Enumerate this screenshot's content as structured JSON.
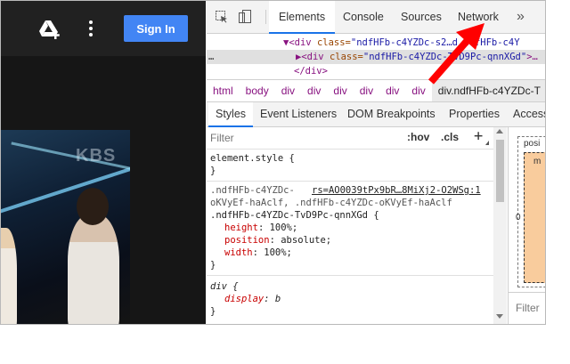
{
  "page": {
    "signin_label": "Sign In",
    "video_watermark": "KBS"
  },
  "devtools": {
    "tabs": [
      "Elements",
      "Console",
      "Sources",
      "Network"
    ],
    "active_tab": "Elements",
    "more_tabs": "»",
    "dom_lines": [
      {
        "prefix": "▼<div ",
        "attr": "class=",
        "val": "\"ndfHFb-c4YZDc-s2…d ndfHFb-c4Y"
      },
      {
        "prefix": "▶<div ",
        "attr": "class=",
        "val": "\"ndfHFb-c4YZDc-TvD9Pc-qnnXGd\"",
        "suffix": ">…",
        "ellipsis": "…"
      },
      {
        "prefix": "</div>",
        "attr": "",
        "val": ""
      }
    ],
    "breadcrumbs": [
      "html",
      "body",
      "div",
      "div",
      "div",
      "div",
      "div",
      "div",
      "div.ndfHFb-c4YZDc-T"
    ],
    "subtabs": [
      "Styles",
      "Event Listeners",
      "DOM Breakpoints",
      "Properties",
      "Access"
    ],
    "active_subtab": "Styles",
    "filter_placeholder": "Filter",
    "hov": ":hov",
    "cls": ".cls",
    "plus": "+",
    "styles": {
      "element_style": "element.style {",
      "close": "}",
      "rule1_selector_line1": "ndfHFb-c4YZDc-",
      "rule1_selector_line1_prefix": ".",
      "rule1_link": "rs=AO0039tPx9bR…8MiXj2-O2WSg:1",
      "rule1_selector_line2": "oKVyEf-haAclf, .ndfHFb-c4YZDc-oKVyEf-haAclf",
      "rule1_selector_line3": ".ndfHFb-c4YZDc-TvD9Pc-qnnXGd {",
      "rule1_props": [
        {
          "name": "height",
          "value": "100%;"
        },
        {
          "name": "position",
          "value": "absolute;"
        },
        {
          "name": "width",
          "value": "100%;"
        }
      ],
      "rule2_selector": "div {",
      "rule2_prop_name": "display",
      "rule2_prop_value": "b"
    },
    "boxmodel": {
      "label": "posi",
      "margin_label": "m",
      "zero": "0",
      "filter": "Filter"
    }
  },
  "colors": {
    "accent": "#1a73e8",
    "signin": "#4285f4",
    "arrow": "#ff0000"
  }
}
